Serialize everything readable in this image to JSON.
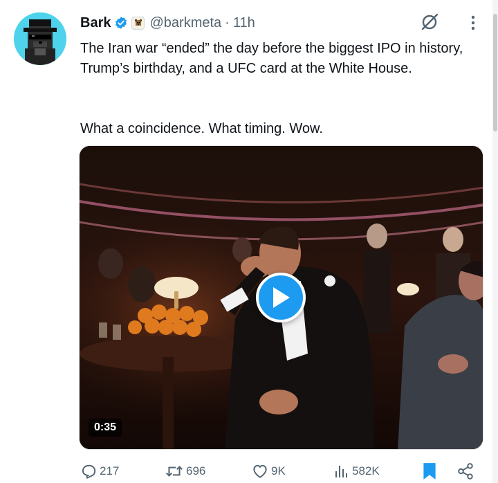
{
  "tweet": {
    "author": {
      "display_name": "Bark",
      "handle": "@barkmeta",
      "verified_icon": "verified-badge-icon",
      "affiliation_icon": "dog-affiliation-icon",
      "avatar_color": "#4fd3ec"
    },
    "dot": "·",
    "time": "11h",
    "text_paragraph_1": "The Iran war “ended” the day before the biggest IPO in history, Trump’s birthday, and a UFC card at the White House.",
    "text_paragraph_2": "What a coincidence. What timing. Wow.",
    "media": {
      "type": "video",
      "duration": "0:35",
      "play_icon": "play-icon"
    },
    "actions": {
      "replies": "217",
      "reposts": "696",
      "likes": "9K",
      "views": "582K",
      "bookmark_icon": "bookmark-icon",
      "share_icon": "share-icon"
    }
  },
  "colors": {
    "accent": "#1d9bf0",
    "secondary_text": "#536471",
    "primary_text": "#0f1419"
  }
}
